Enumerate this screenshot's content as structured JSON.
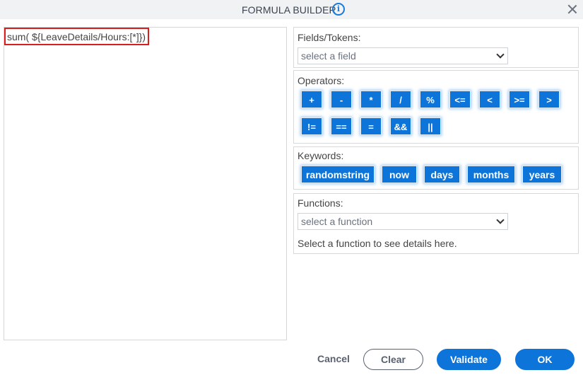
{
  "dialog": {
    "title": "FORMULA BUILDER",
    "info_icon": "info-circle-icon",
    "close_icon": "close-x-icon"
  },
  "editor": {
    "formula": "sum( ${LeaveDetails/Hours:[*]})"
  },
  "fields": {
    "label": "Fields/Tokens:",
    "placeholder": "select a field"
  },
  "operators": {
    "label": "Operators:",
    "row1": [
      "+",
      "-",
      "*",
      "/",
      "%",
      "<=",
      "<",
      ">=",
      ">"
    ],
    "row2": [
      "!=",
      "==",
      "=",
      "&&",
      "||"
    ]
  },
  "keywords": {
    "label": "Keywords:",
    "items": [
      "randomstring",
      "now",
      "days",
      "months",
      "years"
    ]
  },
  "functions": {
    "label": "Functions:",
    "placeholder": "select a function",
    "hint": "Select a function to see details here."
  },
  "footer": {
    "cancel": "Cancel",
    "clear": "Clear",
    "validate": "Validate",
    "ok": "OK"
  },
  "colors": {
    "accent": "#0d74d9",
    "highlight_border": "#d91e1e",
    "header_bg": "#f1f2f4"
  }
}
